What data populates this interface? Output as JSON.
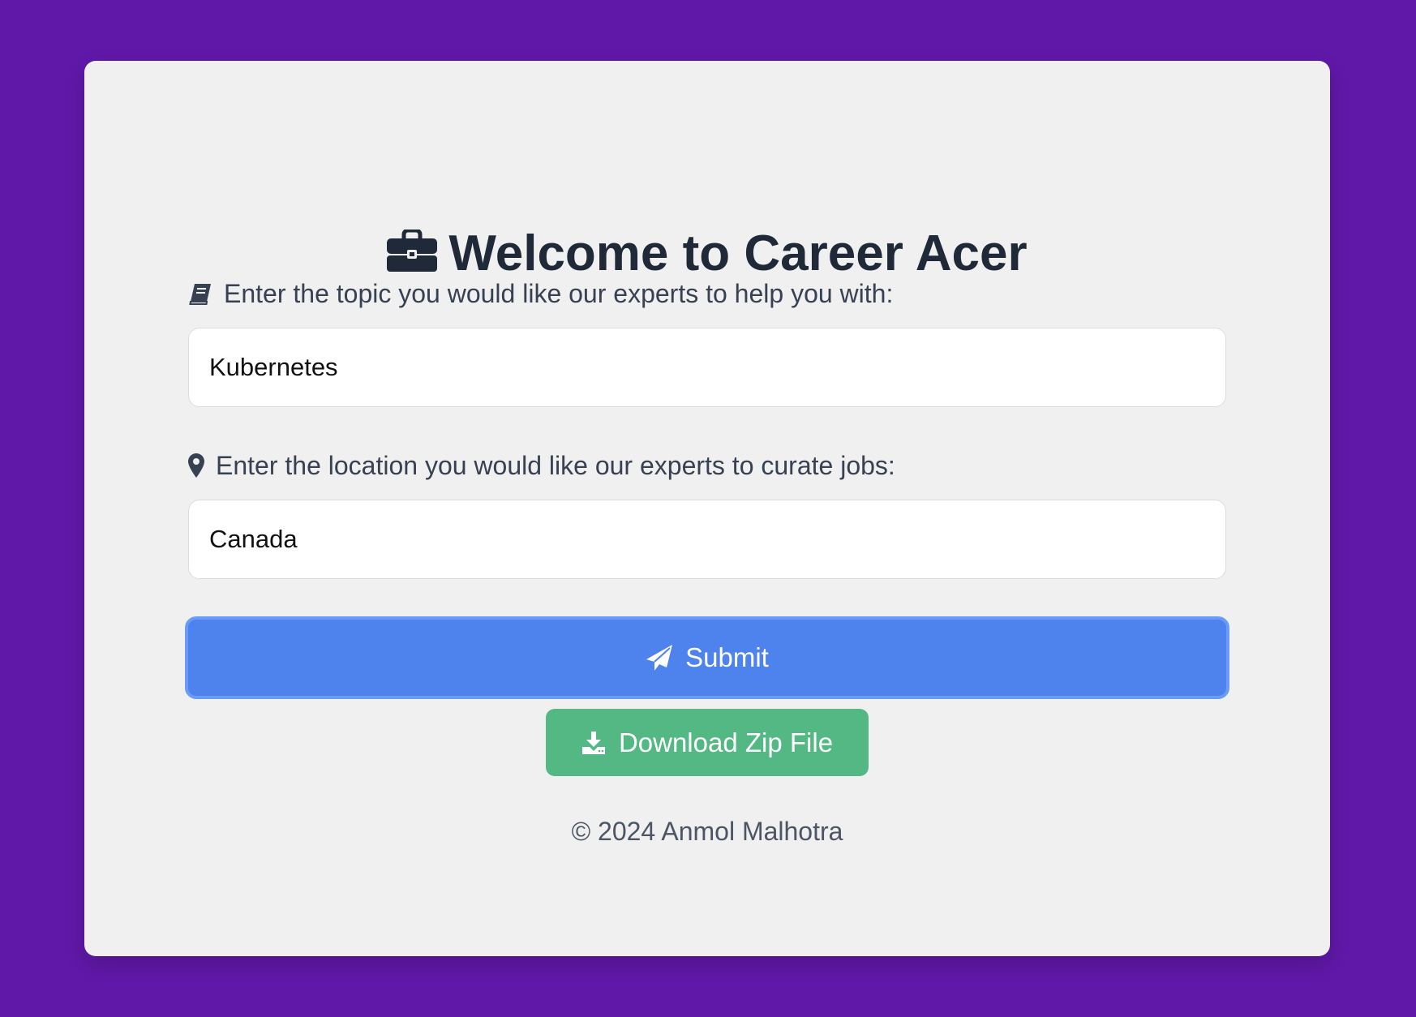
{
  "header": {
    "title": "Welcome to Career Acer",
    "icon": "briefcase-icon"
  },
  "form": {
    "topic": {
      "label": "Enter the topic you would like our experts to help you with:",
      "icon": "book-icon",
      "value": "Kubernetes"
    },
    "location": {
      "label": "Enter the location you would like our experts to curate jobs:",
      "icon": "map-marker-icon",
      "value": "Canada"
    },
    "submit": {
      "label": "Submit",
      "icon": "paper-plane-icon",
      "color": "#4e82ec"
    },
    "download": {
      "label": "Download Zip File",
      "icon": "download-icon",
      "color": "#53b883"
    }
  },
  "footer": {
    "text": "© 2024 Anmol Malhotra"
  },
  "colors": {
    "background": "#6018a8",
    "card": "#f0f0f0",
    "heading": "#1f2937"
  }
}
